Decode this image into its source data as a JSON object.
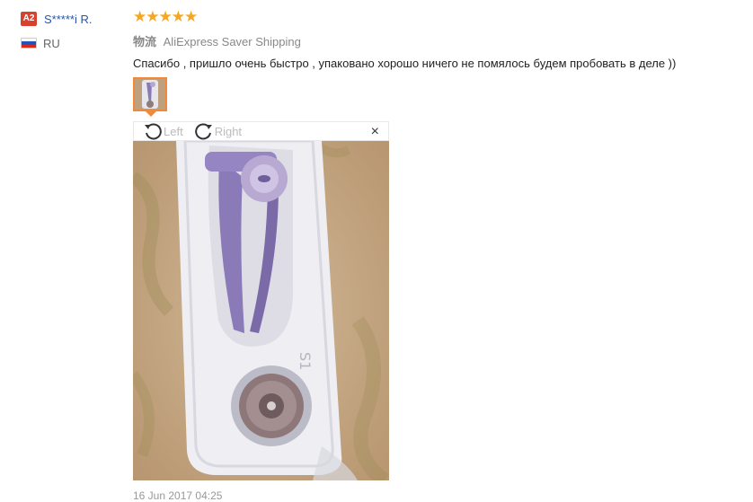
{
  "user": {
    "level_badge": "A2",
    "name": "S*****i R.",
    "country_code": "RU",
    "flag_colors": [
      "#ffffff",
      "#2552b5",
      "#d52b1e"
    ]
  },
  "review": {
    "rating": 5,
    "star_glyphs": [
      "★",
      "★",
      "★",
      "★",
      "★"
    ],
    "shipping_label": "物流",
    "shipping_method": "AliExpress Saver Shipping",
    "text": "Спасибо , пришло очень быстро , упаковано хорошо ничего не помялось будем пробовать в деле ))",
    "date": "16 Jun 2017 04:25"
  },
  "viewer": {
    "rotate_left_label": "Left",
    "rotate_right_label": "Right",
    "close_glyph": "×"
  },
  "colors": {
    "star": "#f5a623",
    "accent_border": "#f0893a",
    "username": "#2356b3",
    "badge": "#d9412f"
  }
}
